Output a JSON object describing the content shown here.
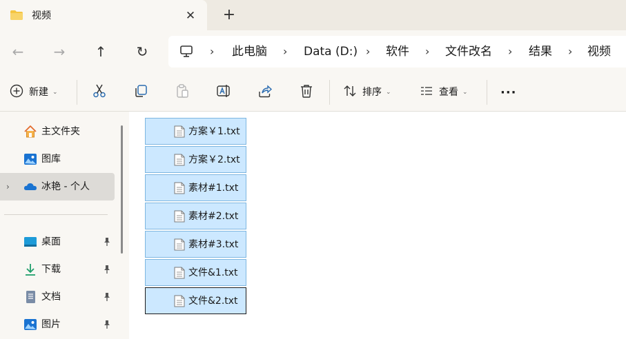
{
  "window": {
    "tab_title": "视频",
    "tab_close": "✕",
    "new_tab": "+"
  },
  "nav": {
    "back": "←",
    "forward": "→",
    "up": "↑",
    "refresh": "↻"
  },
  "breadcrumb": {
    "items": [
      "此电脑",
      "Data (D:)",
      "软件",
      "文件改名",
      "结果",
      "视频"
    ],
    "separator": "›"
  },
  "toolbar": {
    "new_label": "新建",
    "sort_label": "排序",
    "view_label": "查看",
    "more_label": "···",
    "chevron": "⌄"
  },
  "sidebar": {
    "expand_glyph": "›",
    "items": [
      {
        "label": "主文件夹",
        "icon": "home-icon"
      },
      {
        "label": "图库",
        "icon": "gallery-icon"
      },
      {
        "label": "冰艳 - 个人",
        "icon": "onedrive-cloud-icon"
      },
      {
        "label": "桌面",
        "icon": "desktop-icon"
      },
      {
        "label": "下载",
        "icon": "download-icon"
      },
      {
        "label": "文档",
        "icon": "document-icon"
      },
      {
        "label": "图片",
        "icon": "pictures-icon"
      }
    ]
  },
  "files": [
    {
      "name": "方案￥1.txt"
    },
    {
      "name": "方案￥2.txt"
    },
    {
      "name": "素材#1.txt"
    },
    {
      "name": "素材#2.txt"
    },
    {
      "name": "素材#3.txt"
    },
    {
      "name": "文件&1.txt"
    },
    {
      "name": "文件&2.txt"
    }
  ],
  "colors": {
    "selection_fill": "#cce8ff",
    "selection_border": "#7db6e0",
    "chrome_bg": "#f9f7f3",
    "folder_yellow": "#f4c542",
    "onedrive_blue": "#1a73d1"
  }
}
